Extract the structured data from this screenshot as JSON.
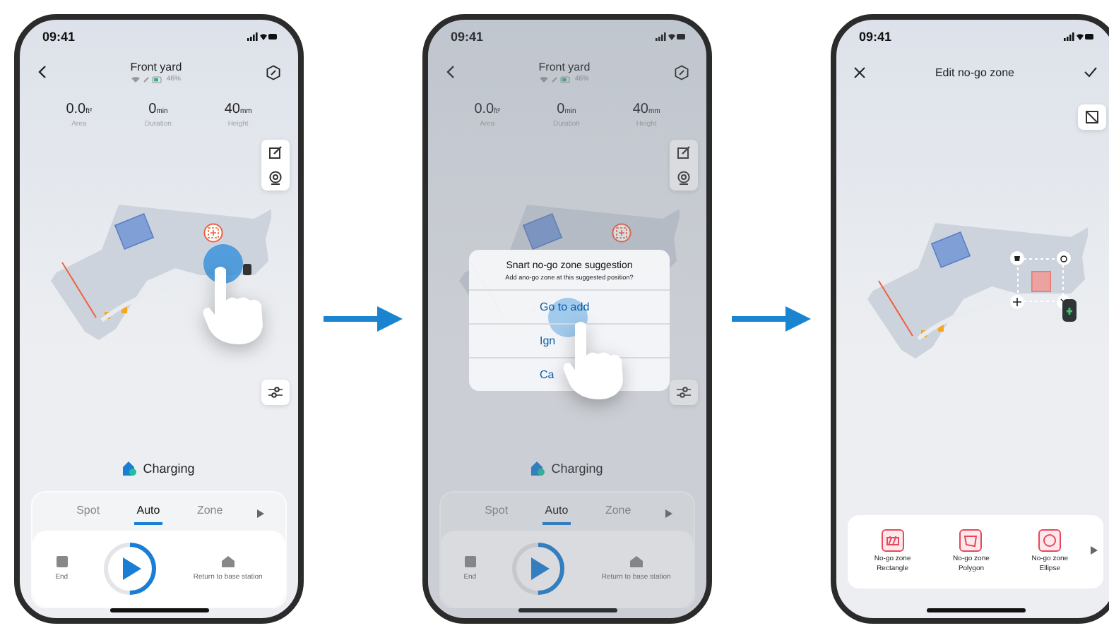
{
  "phones": [
    {
      "kind": "control",
      "dimmed": false,
      "time": "09:41",
      "title": "Front yard",
      "battery": "46%",
      "stats": [
        {
          "value": "0.0",
          "unit": "ft²",
          "label": "Area"
        },
        {
          "value": "0",
          "unit": "min",
          "label": "Duration"
        },
        {
          "value": "40",
          "unit": "mm",
          "label": "Height"
        }
      ],
      "status": "Charging",
      "modes": [
        {
          "label": "Spot",
          "selected": false
        },
        {
          "label": "Auto",
          "selected": true
        },
        {
          "label": "Zone",
          "selected": false
        }
      ],
      "actions": {
        "end": "End",
        "home": "Return to base station",
        "level": 0.5
      }
    },
    {
      "kind": "control",
      "dimmed": true,
      "time": "09:41",
      "title": "Front yard",
      "battery": "46%",
      "stats": [
        {
          "value": "0.0",
          "unit": "ft²",
          "label": "Area"
        },
        {
          "value": "0",
          "unit": "min",
          "label": "Duration"
        },
        {
          "value": "40",
          "unit": "mm",
          "label": "Height"
        }
      ],
      "status": "Charging",
      "modes": [
        {
          "label": "Spot",
          "selected": false
        },
        {
          "label": "Auto",
          "selected": true
        },
        {
          "label": "Zone",
          "selected": false
        }
      ],
      "actions": {
        "end": "End",
        "home": "Return to base station",
        "level": 0.5
      },
      "dialog": {
        "title": "Snart no-go zone suggestion",
        "message": "Add ano-go zone at this suggested position?",
        "options": [
          "Go to add",
          "Ign",
          "Ca"
        ]
      }
    },
    {
      "kind": "edit",
      "time": "09:41",
      "title": "Edit no-go zone",
      "tools": [
        {
          "kind": "rectangle",
          "name": "No-go zone",
          "shape": "Rectangle"
        },
        {
          "kind": "polygon",
          "name": "No-go zone",
          "shape": "Polygon"
        },
        {
          "kind": "ellipse",
          "name": "No-go zone",
          "shape": "Ellipse"
        }
      ]
    }
  ]
}
